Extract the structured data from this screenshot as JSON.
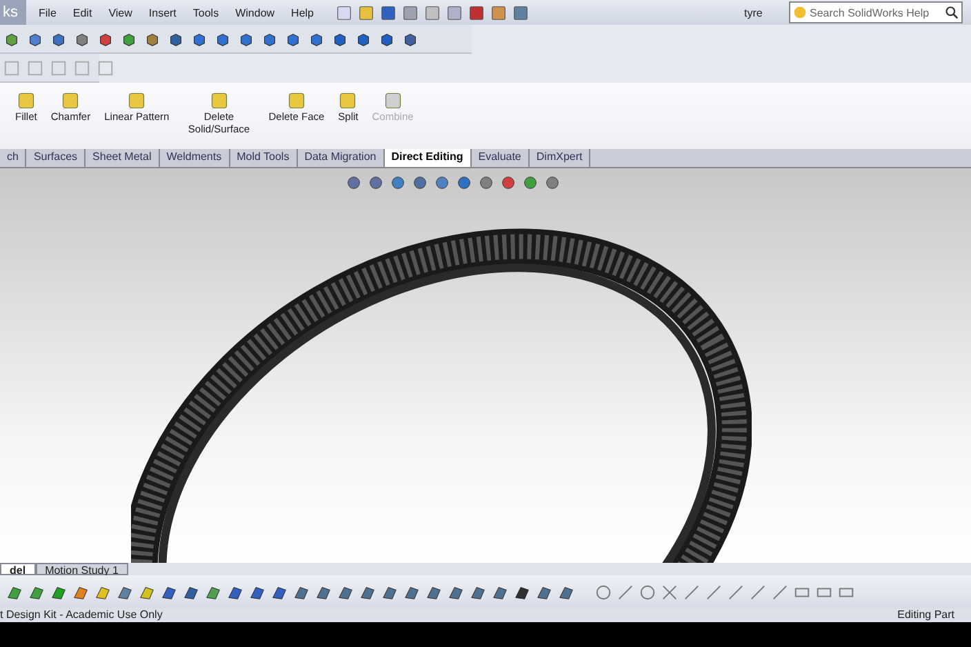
{
  "window": {
    "title_fragment": "ks",
    "document": "tyre"
  },
  "menu": [
    "File",
    "Edit",
    "View",
    "Insert",
    "Tools",
    "Window",
    "Help"
  ],
  "search": {
    "placeholder": "Search SolidWorks Help"
  },
  "ribbon": [
    {
      "label": "Fillet",
      "disabled": false
    },
    {
      "label": "Chamfer",
      "disabled": false
    },
    {
      "label": "Linear Pattern",
      "disabled": false
    },
    {
      "label": "Delete Solid/Surface",
      "disabled": false
    },
    {
      "label": "Delete Face",
      "disabled": false
    },
    {
      "label": "Split",
      "disabled": false
    },
    {
      "label": "Combine",
      "disabled": true
    }
  ],
  "tabs": [
    {
      "label": "ch",
      "selected": false
    },
    {
      "label": "Surfaces",
      "selected": false
    },
    {
      "label": "Sheet Metal",
      "selected": false
    },
    {
      "label": "Weldments",
      "selected": false
    },
    {
      "label": "Mold Tools",
      "selected": false
    },
    {
      "label": "Data Migration",
      "selected": false
    },
    {
      "label": "Direct Editing",
      "selected": true
    },
    {
      "label": "Evaluate",
      "selected": false
    },
    {
      "label": "DimXpert",
      "selected": false
    }
  ],
  "bottom_tabs": [
    {
      "label": "del",
      "selected": true
    },
    {
      "label": "Motion Study 1",
      "selected": false
    }
  ],
  "status_bar": {
    "left": "t Design Kit - Academic Use Only",
    "right": "Editing Part"
  }
}
